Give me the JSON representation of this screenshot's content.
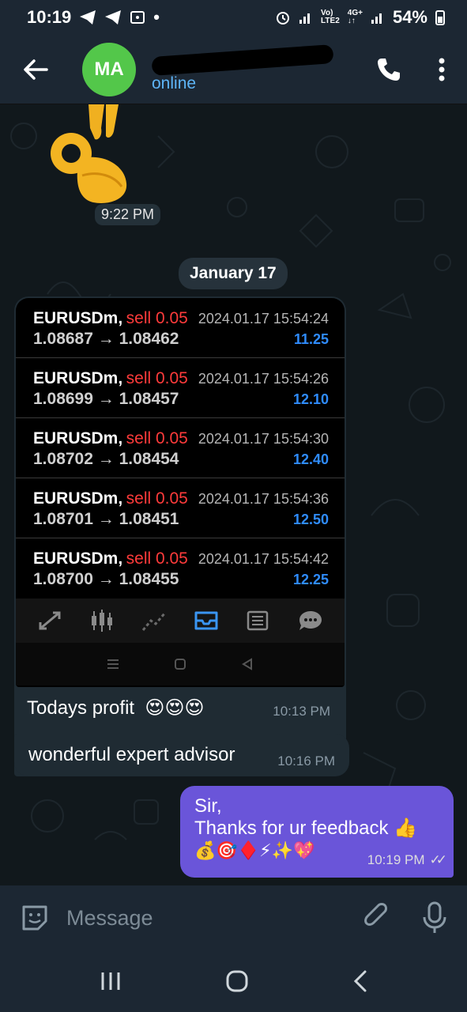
{
  "status_bar": {
    "time": "10:19",
    "network_top": "Vo)",
    "network_bottom": "LTE2",
    "net2_top": "4G+",
    "net2_bottom": "↓↑",
    "battery": "54%"
  },
  "header": {
    "avatar_initials": "MA",
    "status": "online"
  },
  "chat": {
    "sticker_time": "9:22 PM",
    "date_chip": "January 17",
    "trades": [
      {
        "symbol": "EURUSDm,",
        "side": "sell 0.05",
        "datetime": "2024.01.17 15:54:24",
        "prices": "1.08687 → 1.08462",
        "profit": "11.25"
      },
      {
        "symbol": "EURUSDm,",
        "side": "sell 0.05",
        "datetime": "2024.01.17 15:54:26",
        "prices": "1.08699 → 1.08457",
        "profit": "12.10"
      },
      {
        "symbol": "EURUSDm,",
        "side": "sell 0.05",
        "datetime": "2024.01.17 15:54:30",
        "prices": "1.08702 → 1.08454",
        "profit": "12.40"
      },
      {
        "symbol": "EURUSDm,",
        "side": "sell 0.05",
        "datetime": "2024.01.17 15:54:36",
        "prices": "1.08701 → 1.08451",
        "profit": "12.50"
      },
      {
        "symbol": "EURUSDm,",
        "side": "sell 0.05",
        "datetime": "2024.01.17 15:54:42",
        "prices": "1.08700 → 1.08455",
        "profit": "12.25"
      }
    ],
    "photo_caption": "Todays profit",
    "photo_caption_emoji": "😍😍😍",
    "photo_time": "10:13 PM",
    "msg2_text": "wonderful expert advisor",
    "msg2_time": "10:16 PM",
    "out_line1": "Sir,",
    "out_line2": "Thanks for ur feedback 👍",
    "out_line3": "💰🎯♦️⚡✨💖",
    "out_time": "10:19 PM",
    "out_ticks": "✓✓"
  },
  "input": {
    "placeholder": "Message"
  },
  "colors": {
    "accent": "#5eb5f7",
    "outgoing_bubble": "#6a55d9",
    "avatar": "#53c74a",
    "sell_red": "#ff3b3b",
    "profit_blue": "#2f8cff"
  },
  "icons": [
    "back-arrow-icon",
    "phone-icon",
    "more-vert-icon",
    "sticker-icon",
    "attach-icon",
    "mic-icon"
  ]
}
